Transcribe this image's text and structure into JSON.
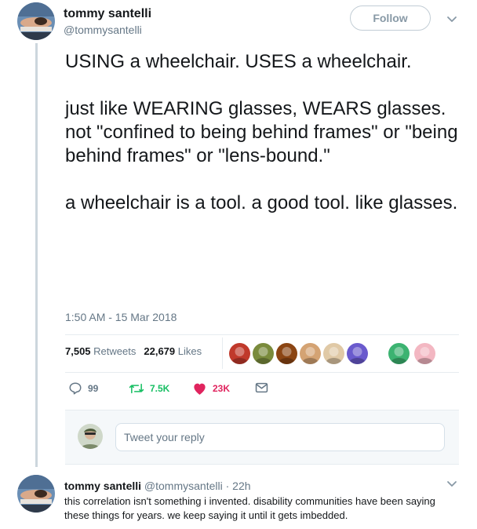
{
  "tweet": {
    "author_name": "tommy santelli",
    "author_handle": "@tommysantelli",
    "follow_label": "Follow",
    "paragraphs": [
      "USING a wheelchair. USES a wheelchair.",
      "just like WEARING glasses, WEARS glasses.\nnot \"confined to being behind frames\" or \"being behind frames\" or \"lens-bound.\"",
      "a wheelchair is a tool. a good tool. like glasses."
    ],
    "timestamp": "1:50 AM - 15 Mar 2018",
    "retweets_count": "7,505",
    "retweets_label": "Retweets",
    "likes_count": "22,679",
    "likes_label": "Likes",
    "action_counts": {
      "replies": "99",
      "retweets": "7.5K",
      "likes": "23K"
    },
    "liker_avatar_colors": [
      "#c0392b",
      "#7a8b3c",
      "#8b4513",
      "#d4a373",
      "#e0c9a6",
      "#6a5acd",
      "#3cb371",
      "#f3b7c2"
    ]
  },
  "reply_box": {
    "placeholder": "Tweet your reply"
  },
  "reply_tweet": {
    "author_name": "tommy santelli",
    "author_handle": "@tommysantelli",
    "separator": "·",
    "time": "22h",
    "text": "this correlation isn't something i invented. disability communities have been saying these things for years. we keep saying it until it gets imbedded."
  },
  "colors": {
    "accent": "#1da1f2",
    "retweet_green": "#17bf63",
    "like_red": "#e0245e",
    "muted": "#657786"
  },
  "icons": [
    "reply-icon",
    "retweet-icon",
    "heart-icon",
    "direct-message-icon",
    "chevron-down-icon"
  ]
}
